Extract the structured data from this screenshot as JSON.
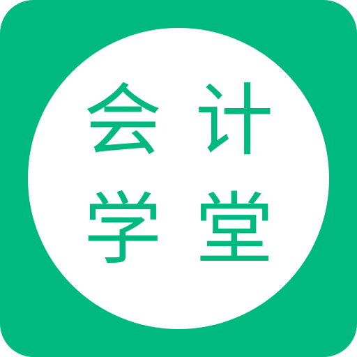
{
  "logo": {
    "characters": [
      "会",
      "计",
      "学",
      "堂"
    ],
    "colors": {
      "background": "#00b97d",
      "circle": "#ffffff",
      "text": "#00b97d"
    }
  }
}
